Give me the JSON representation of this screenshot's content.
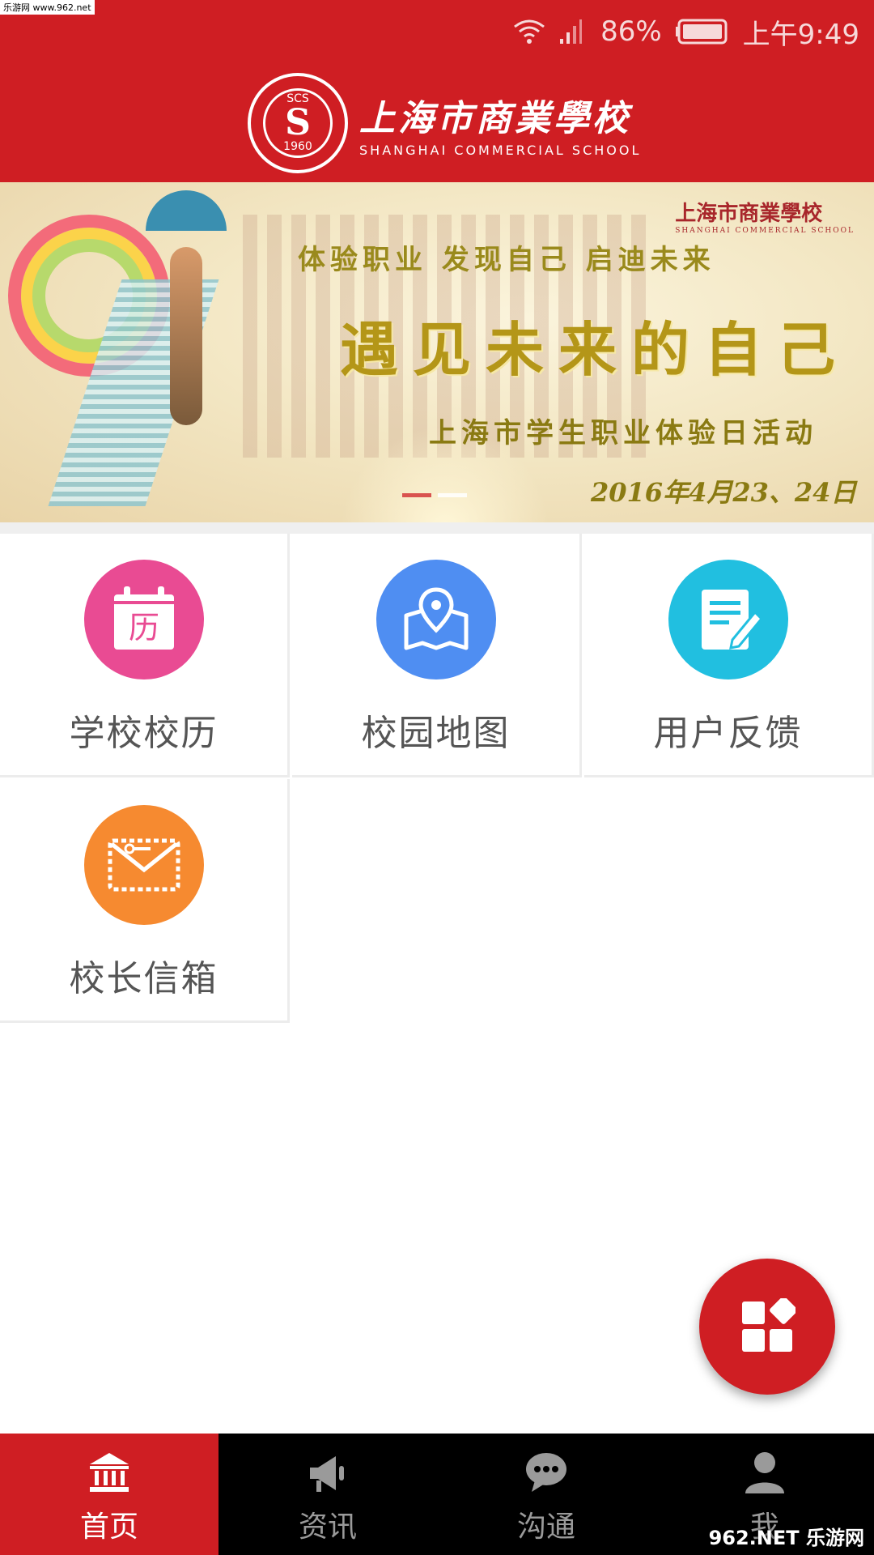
{
  "watermark": "乐游网 www.962.net",
  "status_bar": {
    "battery_percent": "86%",
    "time": "上午9:49"
  },
  "header": {
    "logo_cn": "上海市商業學校",
    "logo_en": "SHANGHAI  COMMERCIAL  SCHOOL",
    "seal_top": "SCS",
    "seal_year": "1960"
  },
  "banner": {
    "logo_cn": "上海市商業學校",
    "logo_en": "SHANGHAI COMMERCIAL SCHOOL",
    "slogan": "体验职业  发现自己  启迪未来",
    "headline": "遇见未来的自己",
    "subhead": "上海市学生职业体验日活动",
    "date": "2016年4月23、24日",
    "page_index": 1,
    "page_count": 2
  },
  "grid": [
    {
      "label": "学校校历",
      "icon": "calendar-icon",
      "color": "#e94b93",
      "glyph": "历"
    },
    {
      "label": "校园地图",
      "icon": "map-pin-icon",
      "color": "#4f8ef2"
    },
    {
      "label": "用户反馈",
      "icon": "feedback-edit-icon",
      "color": "#21bfe0"
    },
    {
      "label": "校长信箱",
      "icon": "mail-icon",
      "color": "#f68a30"
    }
  ],
  "fab": {
    "icon": "apps-grid-icon"
  },
  "tabs": [
    {
      "label": "首页",
      "icon": "bank-icon",
      "active": true
    },
    {
      "label": "资讯",
      "icon": "megaphone-icon",
      "active": false
    },
    {
      "label": "沟通",
      "icon": "chat-bubble-icon",
      "active": false
    },
    {
      "label": "我",
      "icon": "user-icon",
      "active": false
    }
  ],
  "corner_watermark": "962.NET 乐游网",
  "colors": {
    "brand_red": "#cf1e23",
    "tab_bg": "#000000"
  }
}
